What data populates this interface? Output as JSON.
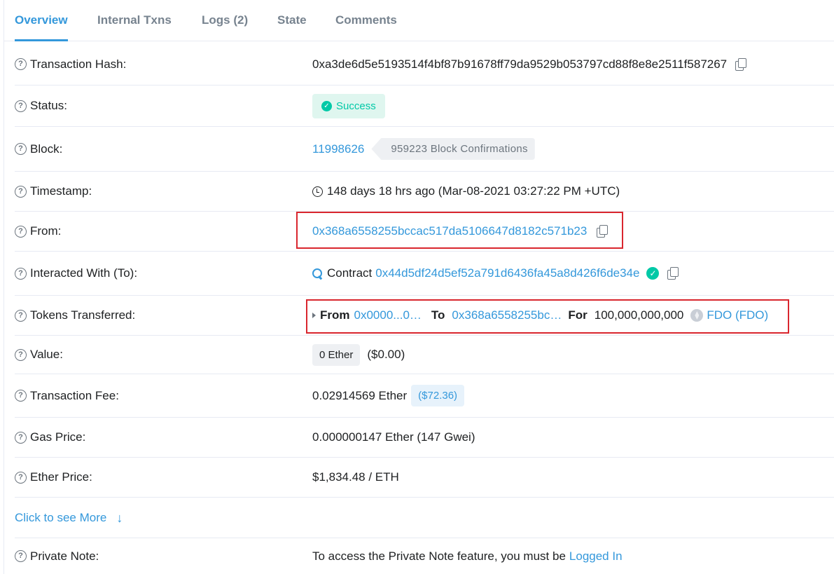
{
  "tabs": [
    {
      "label": "Overview",
      "active": true
    },
    {
      "label": "Internal Txns"
    },
    {
      "label": "Logs (2)"
    },
    {
      "label": "State"
    },
    {
      "label": "Comments"
    }
  ],
  "fields": {
    "tx_hash": {
      "label": "Transaction Hash:",
      "value": "0xa3de6d5e5193514f4bf87b91678ff79da9529b053797cd88f8e8e2511f587267"
    },
    "status": {
      "label": "Status:",
      "value": "Success"
    },
    "block": {
      "label": "Block:",
      "number": "11998626",
      "confirmations": "959223 Block Confirmations"
    },
    "timestamp": {
      "label": "Timestamp:",
      "value": "148 days 18 hrs ago (Mar-08-2021 03:27:22 PM +UTC)"
    },
    "from": {
      "label": "From:",
      "value": "0x368a6558255bccac517da5106647d8182c571b23"
    },
    "interacted": {
      "label": "Interacted With (To):",
      "prefix": "Contract",
      "address": "0x44d5df24d5ef52a791d6436fa45a8d426f6de34e"
    },
    "tokens": {
      "label": "Tokens Transferred:",
      "from_label": "From",
      "from_value": "0x0000...0…",
      "to_label": "To",
      "to_value": "0x368a6558255bc…",
      "for_label": "For",
      "amount": "100,000,000,000",
      "token": "FDO (FDO)"
    },
    "value": {
      "label": "Value:",
      "ether": "0 Ether",
      "usd": "($0.00)"
    },
    "fee": {
      "label": "Transaction Fee:",
      "value": "0.02914569 Ether",
      "usd": "($72.36)"
    },
    "gas_price": {
      "label": "Gas Price:",
      "value": "0.000000147 Ether (147 Gwei)"
    },
    "ether_price": {
      "label": "Ether Price:",
      "value": "$1,834.48 / ETH"
    },
    "more_link": "Click to see More",
    "private_note": {
      "label": "Private Note:",
      "text": "To access the Private Note feature, you must be",
      "link": "Logged In"
    }
  },
  "colors": {
    "accent": "#3498db",
    "success": "#00c9a7",
    "highlight_box": "#d9262e"
  },
  "icons": [
    "question-icon",
    "copy-icon",
    "check-circle-icon",
    "clock-icon",
    "zoom-icon",
    "verified-icon",
    "caret-right-icon",
    "token-icon",
    "arrow-down-icon"
  ]
}
